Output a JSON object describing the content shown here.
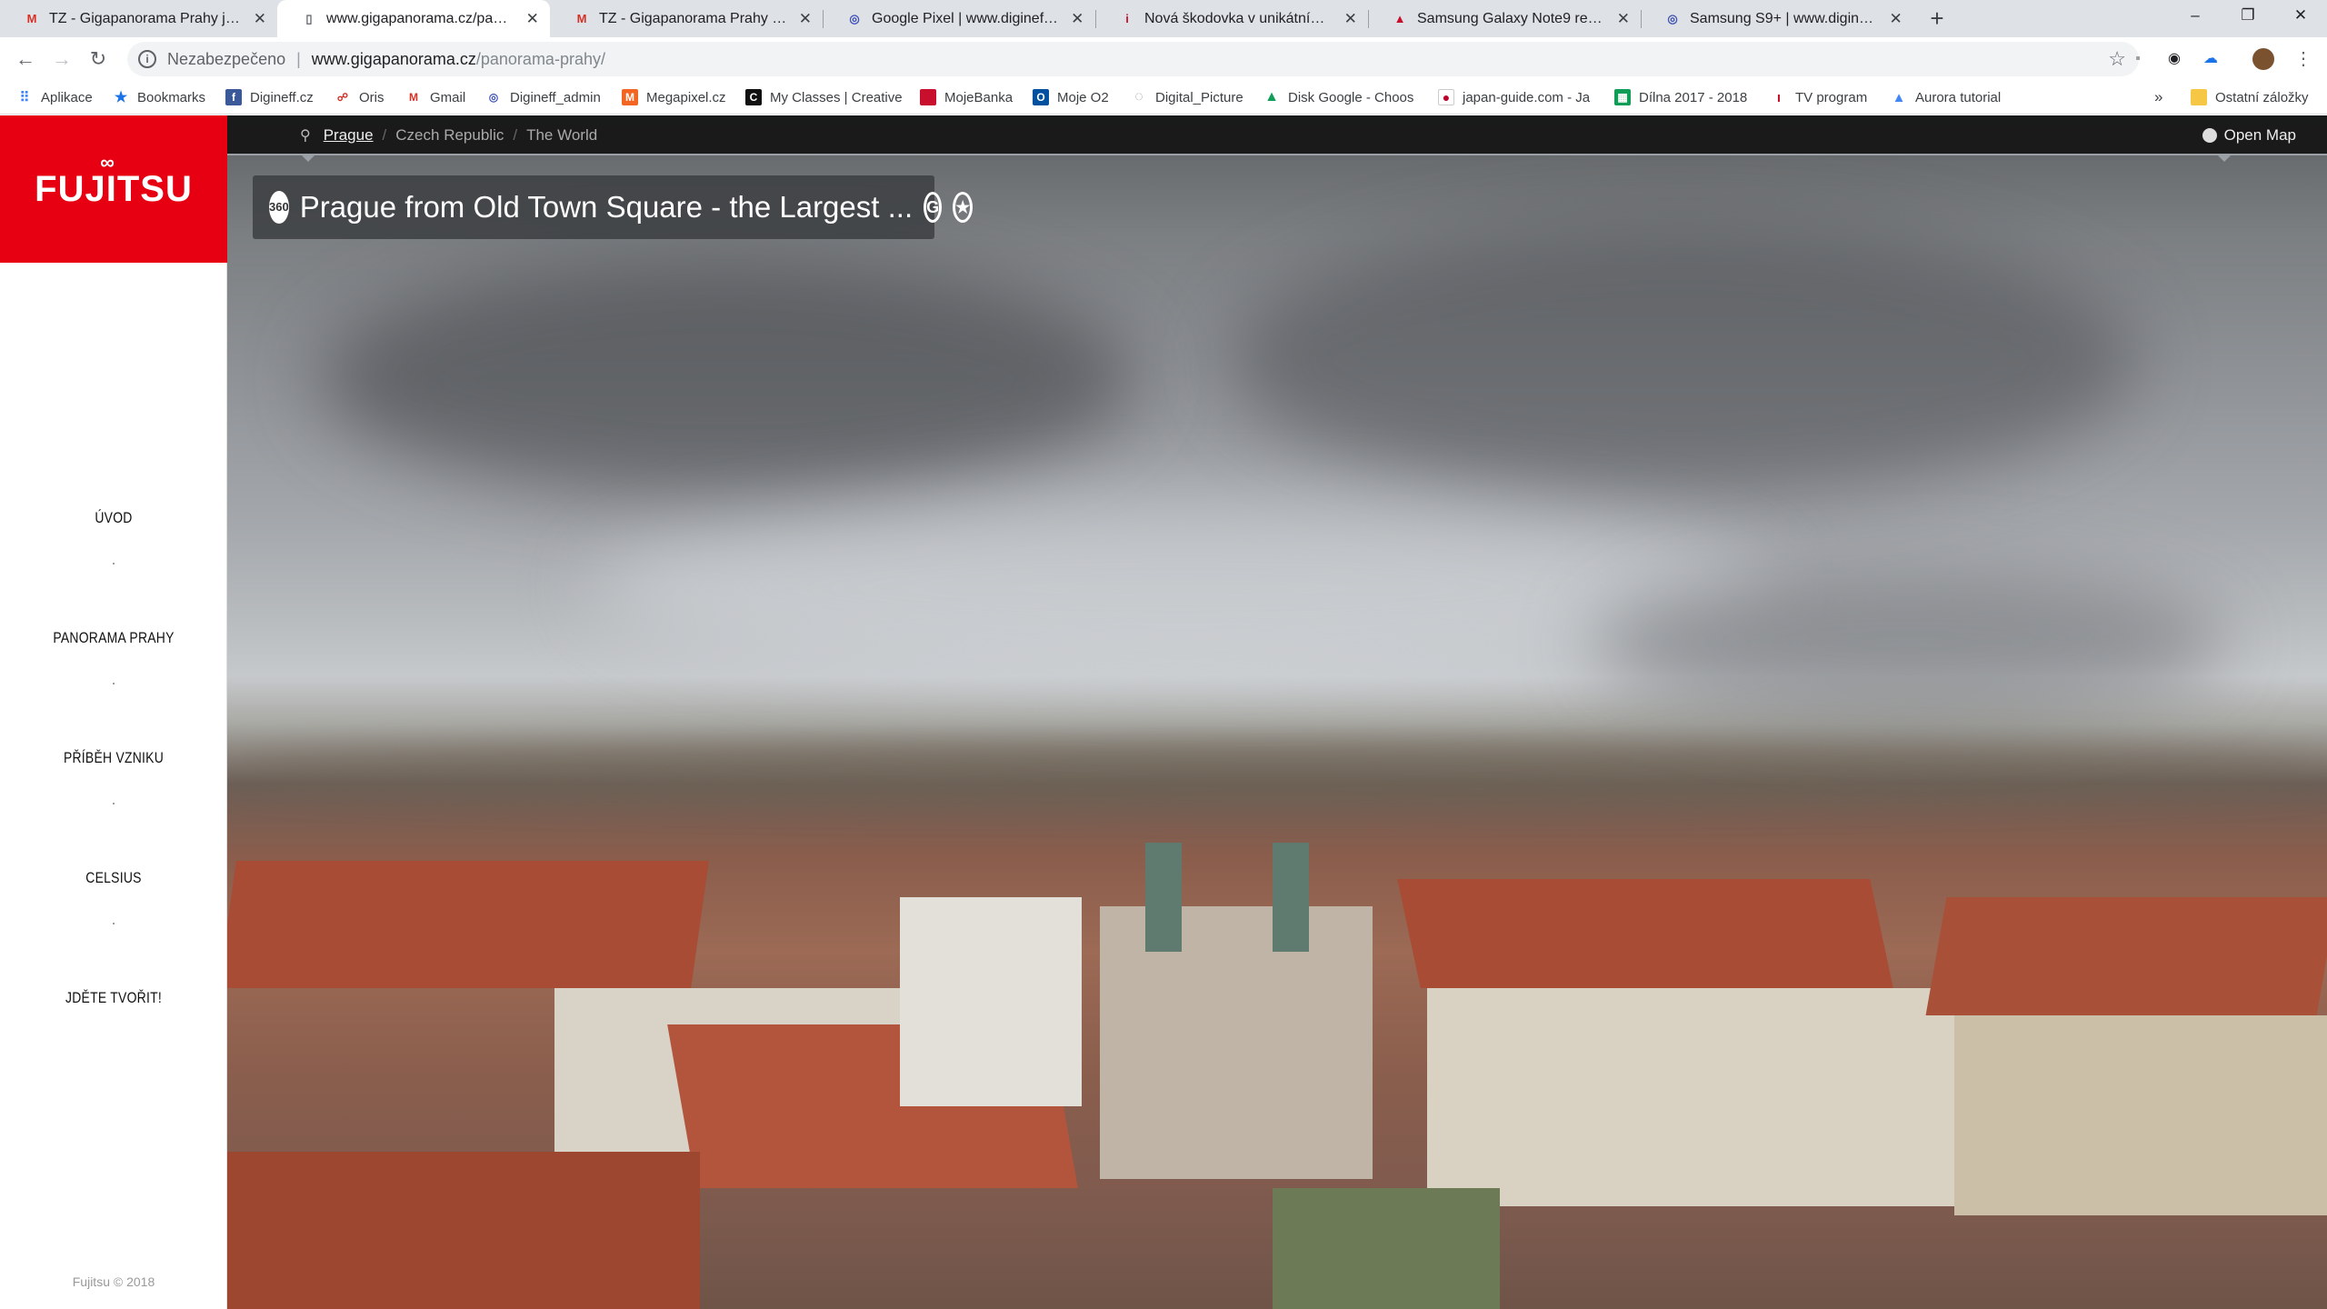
{
  "browser": {
    "tabs": [
      {
        "title": "TZ - Gigapanorama Prahy je dost",
        "icon": "gmail-icon",
        "active": false
      },
      {
        "title": "www.gigapanorama.cz/panoram",
        "icon": "page-icon",
        "active": true
      },
      {
        "title": "TZ - Gigapanorama Prahy je dost",
        "icon": "gmail-icon",
        "active": false
      },
      {
        "title": "Google Pixel | www.digineff.cz",
        "icon": "digineff-icon",
        "active": false
      },
      {
        "title": "Nová škodovka v unikátním graf",
        "icon": "news-icon",
        "active": false
      },
      {
        "title": "Samsung Galaxy Note9 review: C",
        "icon": "gsmarena-icon",
        "active": false
      },
      {
        "title": "Samsung S9+ | www.digineff.cz",
        "icon": "digineff-icon",
        "active": false
      }
    ],
    "address": {
      "security_label": "Nezabezpečeno",
      "host": "www.gigapanorama.cz",
      "path": "/panorama-prahy/"
    },
    "bookmarks": [
      {
        "label": "Aplikace",
        "icon": "apps-grid-icon",
        "color": "#4285f4"
      },
      {
        "label": "Bookmarks",
        "icon": "star-icon",
        "color": "#1a73e8"
      },
      {
        "label": "Digineff.cz",
        "icon": "facebook-icon",
        "color": "#3b5998"
      },
      {
        "label": "Oris",
        "icon": "oris-icon",
        "color": "#d93025"
      },
      {
        "label": "Gmail",
        "icon": "gmail-icon",
        "color": "#d93025"
      },
      {
        "label": "Digineff_admin",
        "icon": "digineff-icon",
        "color": "#3f51b5"
      },
      {
        "label": "Megapixel.cz",
        "icon": "megapixel-icon",
        "color": "#f26522"
      },
      {
        "label": "My Classes | Creative",
        "icon": "creativelive-icon",
        "color": "#111111"
      },
      {
        "label": "MojeBanka",
        "icon": "bank-icon",
        "color": "#c8102e"
      },
      {
        "label": "Moje O2",
        "icon": "o2-icon",
        "color": "#0050a0"
      },
      {
        "label": "Digital_Picture",
        "icon": "loading-icon",
        "color": "#9aa0a6"
      },
      {
        "label": "Disk Google - Choos",
        "icon": "google-drive-icon",
        "color": "#0f9d58"
      },
      {
        "label": "japan-guide.com - Ja",
        "icon": "japan-flag-icon",
        "color": "#bc002d"
      },
      {
        "label": "Dílna 2017 - 2018",
        "icon": "sheets-icon",
        "color": "#0f9d58"
      },
      {
        "label": "TV program",
        "icon": "tv-icon",
        "color": "#c8102e"
      },
      {
        "label": "Aurora tutorial",
        "icon": "aurora-icon",
        "color": "#4285f4"
      }
    ],
    "other_bookmarks": "Ostatní záložky",
    "overflow": "»"
  },
  "site": {
    "logo_text": "FUJITSU",
    "nav": [
      {
        "label": "ÚVOD"
      },
      {
        "label": "PANORAMA PRAHY"
      },
      {
        "label": "PŘÍBĚH VZNIKU"
      },
      {
        "label": "CELSIUS"
      },
      {
        "label": "JDĚTE TVOŘIT!"
      }
    ],
    "footer": "Fujitsu © 2018"
  },
  "viewer": {
    "breadcrumbs": [
      "Prague",
      "Czech Republic",
      "The World"
    ],
    "open_map": "Open Map",
    "title": "Prague from Old Town Square - the Largest ...",
    "badge": "360",
    "g_icon": "G",
    "star_icon": "★"
  }
}
